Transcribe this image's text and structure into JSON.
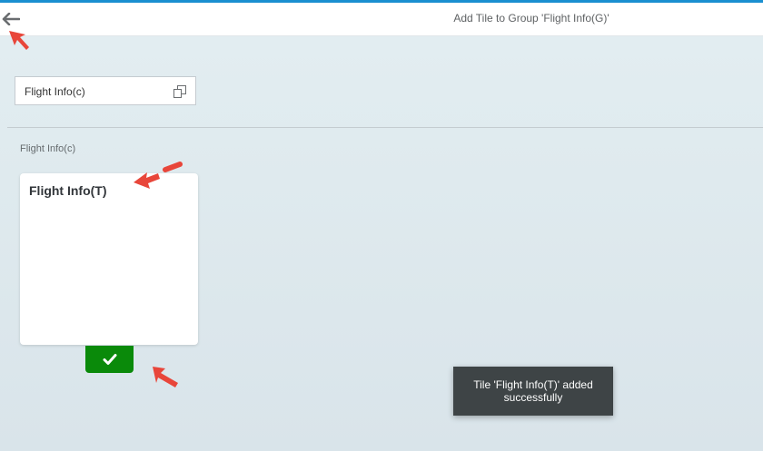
{
  "header": {
    "title": "Add Tile to Group 'Flight Info(G)'",
    "back_icon": "back-arrow-icon"
  },
  "catalog_select": {
    "value": "Flight Info(c)",
    "icon": "copy-icon"
  },
  "group": {
    "label": "Flight Info(c)"
  },
  "tile": {
    "title": "Flight Info(T)",
    "added_icon": "checkmark-icon"
  },
  "toast": {
    "message": "Tile 'Flight Info(T)' added successfully"
  },
  "colors": {
    "accent": "#1a8fd0",
    "success": "#0a8a0a",
    "toast_bg": "#3e4446",
    "annotation": "#e8463a"
  }
}
